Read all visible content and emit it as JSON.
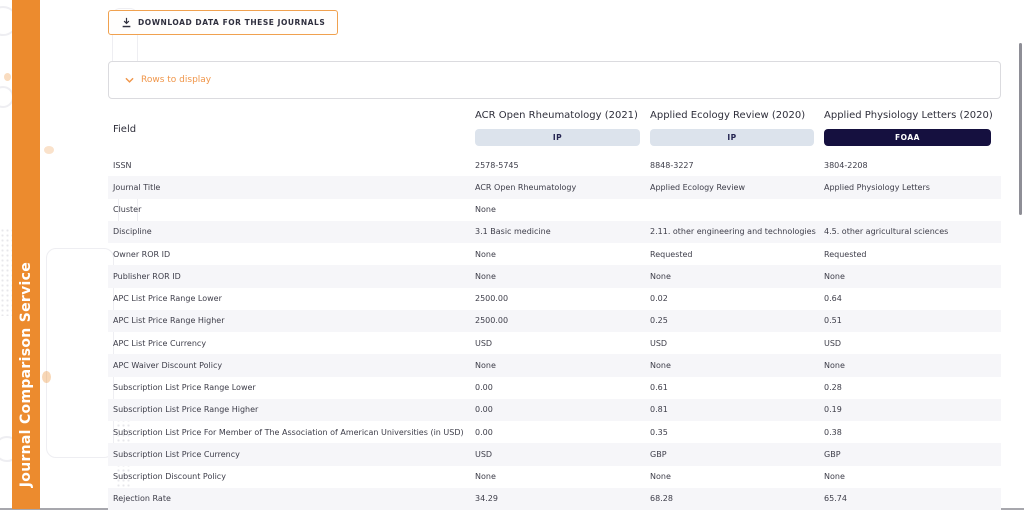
{
  "app": {
    "sidebar_title": "Journal Comparison Service"
  },
  "toolbar": {
    "download_button": "DOWNLOAD DATA FOR THESE JOURNALS"
  },
  "filters": {
    "rows_to_display_label": "Rows to display"
  },
  "comparison_table": {
    "field_column_header": "Field",
    "journals": [
      {
        "name": "ACR Open Rheumatology (2021)",
        "badge": "IP",
        "badge_variant": "light"
      },
      {
        "name": "Applied Ecology Review (2020)",
        "badge": "IP",
        "badge_variant": "light"
      },
      {
        "name": "Applied Physiology Letters (2020)",
        "badge": "FOAA",
        "badge_variant": "dark"
      }
    ],
    "rows": [
      {
        "field": "ISSN",
        "values": [
          "2578-5745",
          "8848-3227",
          "3804-2208"
        ]
      },
      {
        "field": "Journal Title",
        "values": [
          "ACR Open Rheumatology",
          "Applied Ecology Review",
          "Applied Physiology Letters"
        ]
      },
      {
        "field": "Cluster",
        "values": [
          "None",
          "",
          ""
        ]
      },
      {
        "field": "Discipline",
        "values": [
          "3.1 Basic medicine",
          "2.11. other engineering and technologies",
          "4.5. other agricultural sciences"
        ]
      },
      {
        "field": "Owner ROR ID",
        "values": [
          "None",
          "Requested",
          "Requested"
        ]
      },
      {
        "field": "Publisher ROR ID",
        "values": [
          "None",
          "None",
          "None"
        ]
      },
      {
        "field": "APC List Price Range Lower",
        "values": [
          "2500.00",
          "0.02",
          "0.64"
        ]
      },
      {
        "field": "APC List Price Range Higher",
        "values": [
          "2500.00",
          "0.25",
          "0.51"
        ]
      },
      {
        "field": "APC List Price Currency",
        "values": [
          "USD",
          "USD",
          "USD"
        ]
      },
      {
        "field": "APC Waiver Discount Policy",
        "values": [
          "None",
          "None",
          "None"
        ]
      },
      {
        "field": "Subscription List Price Range Lower",
        "values": [
          "0.00",
          "0.61",
          "0.28"
        ]
      },
      {
        "field": "Subscription List Price Range Higher",
        "values": [
          "0.00",
          "0.81",
          "0.19"
        ]
      },
      {
        "field": "Subscription List Price For Member of The Association of American Universities (in USD)",
        "values": [
          "0.00",
          "0.35",
          "0.38"
        ]
      },
      {
        "field": "Subscription List Price Currency",
        "values": [
          "USD",
          "GBP",
          "GBP"
        ]
      },
      {
        "field": "Subscription Discount Policy",
        "values": [
          "None",
          "None",
          "None"
        ]
      },
      {
        "field": "Rejection Rate",
        "values": [
          "34.29",
          "68.28",
          "65.74"
        ]
      }
    ]
  },
  "colors": {
    "accent_orange": "#EC8B2E",
    "accent_orange_light": "#F0964A",
    "badge_light_bg": "#DCE3EC",
    "badge_light_text": "#232350",
    "badge_dark_bg": "#15103F",
    "badge_dark_text": "#FFFFFF",
    "row_stripe": "#F6F6F9",
    "text_primary": "#3D3D49"
  }
}
